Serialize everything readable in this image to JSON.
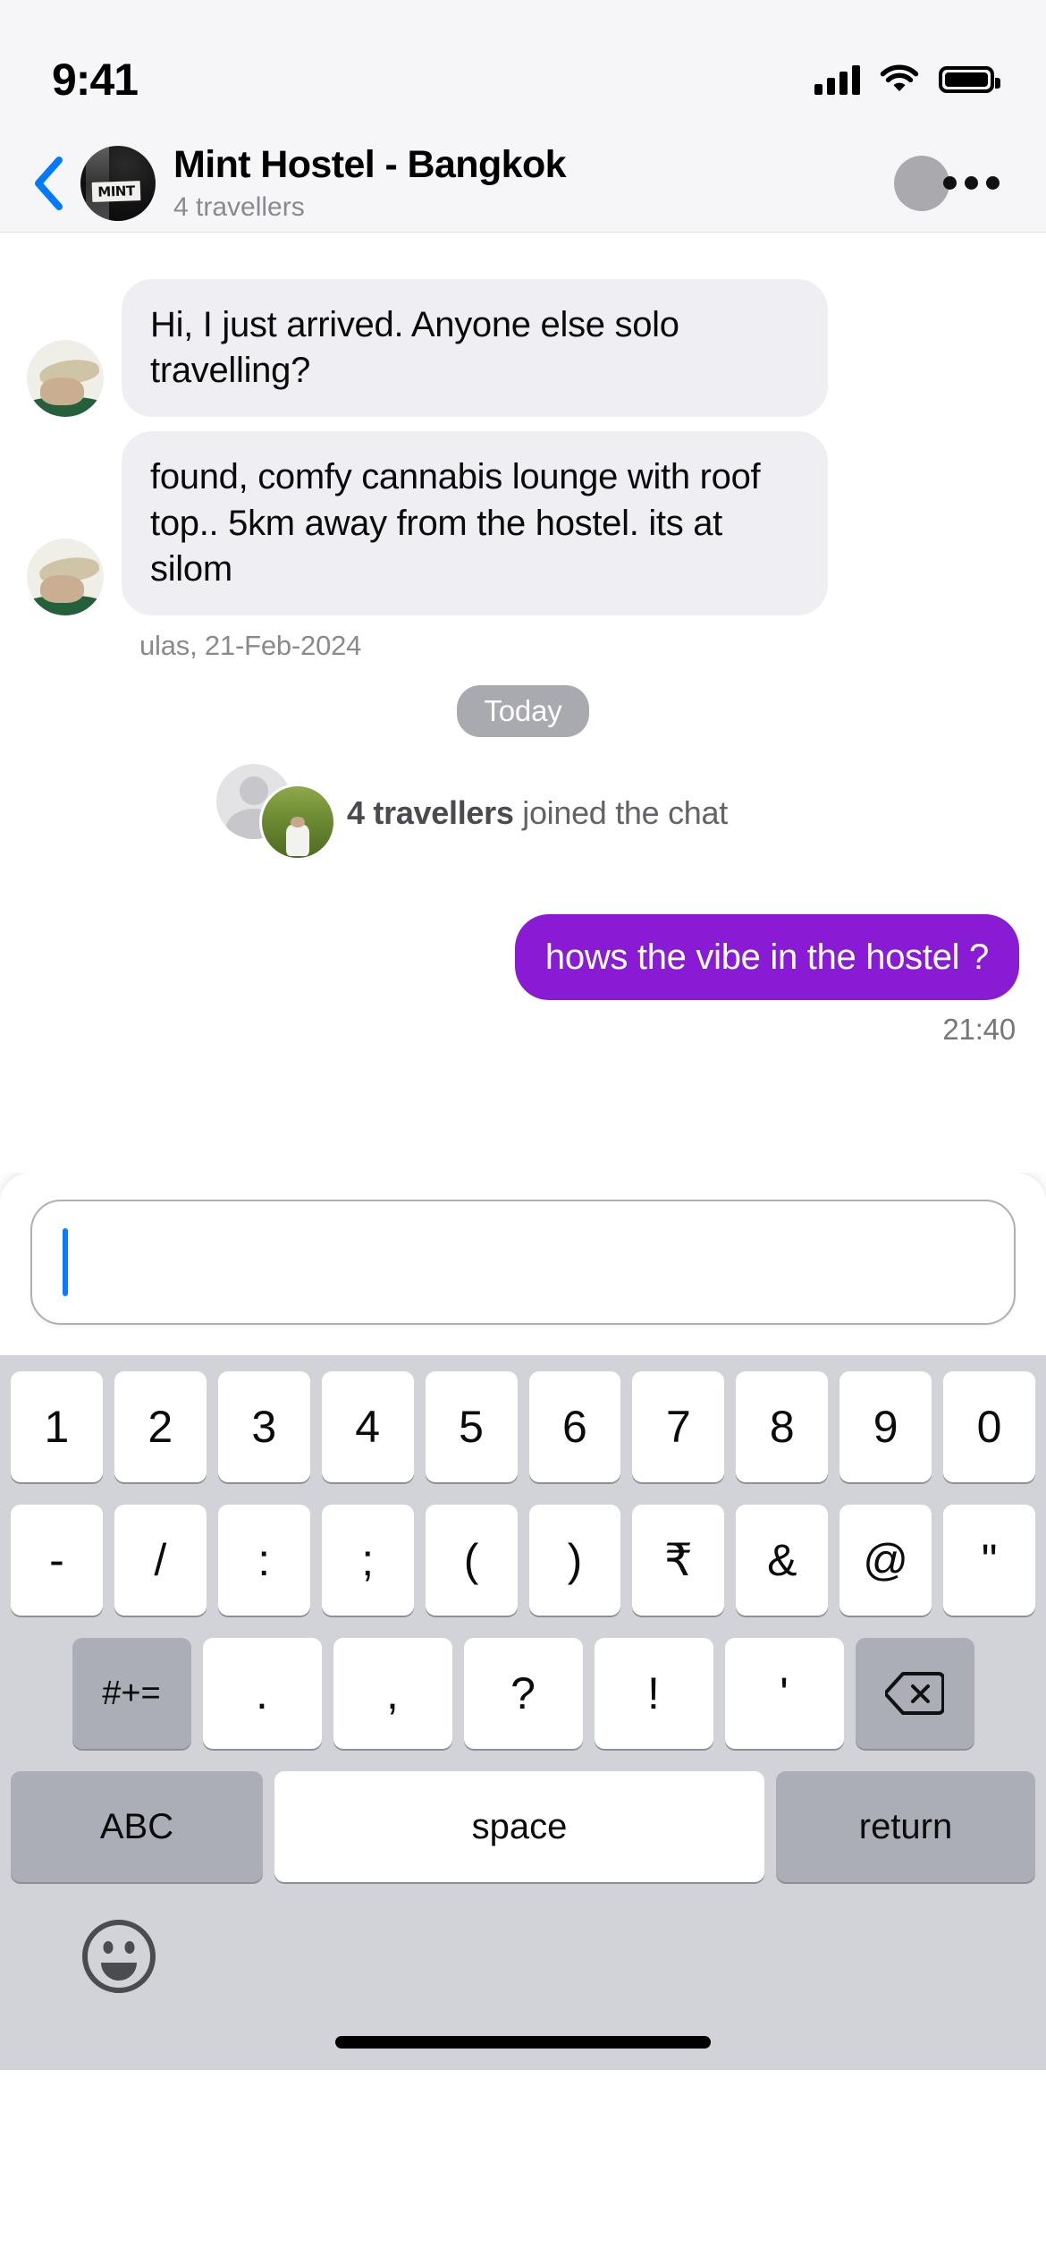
{
  "status_bar": {
    "time": "9:41",
    "signal_icon": "cellular-bars-icon",
    "wifi_icon": "wifi-icon",
    "battery_icon": "battery-full-icon"
  },
  "header": {
    "back_icon": "chevron-left-icon",
    "avatar_label": "MINT",
    "avatar_icon": "hostel-avatar",
    "title": "Mint Hostel - Bangkok",
    "subtitle": "4 travellers",
    "member_badge_icon": "member-avatar-icon",
    "more_icon": "more-options-icon",
    "back_color": "#007AFF"
  },
  "chat": {
    "messages": [
      {
        "id": "msg-1",
        "type": "incoming",
        "text": "Hi, I just arrived. Anyone else solo travelling?",
        "avatar_icon": "ulas-avatar"
      },
      {
        "id": "msg-2",
        "type": "incoming",
        "text": "found, comfy cannabis lounge with roof top.. 5km away from the hostel. its at silom",
        "avatar_icon": "ulas-avatar",
        "meta": "ulas, 21-Feb-2024"
      }
    ],
    "day_divider": "Today",
    "system_event": {
      "bold_text": "4 travellers",
      "rest_text": " joined the chat",
      "avatar_one_icon": "placeholder-avatar-icon",
      "avatar_two_icon": "traveller-avatar"
    },
    "outgoing": {
      "id": "msg-3",
      "text": "hows the vibe in the hostel ?",
      "time": "21:40",
      "bubble_color": "#8A1BD4"
    }
  },
  "composer": {
    "value": "",
    "placeholder": "",
    "caret_color": "#0A7CFF"
  },
  "keyboard": {
    "row1": [
      "1",
      "2",
      "3",
      "4",
      "5",
      "6",
      "7",
      "8",
      "9",
      "0"
    ],
    "row2": [
      "-",
      "/",
      ":",
      ";",
      "(",
      ")",
      "₹",
      "&",
      "@",
      "\""
    ],
    "row3_symbols_label": "#+=",
    "row3": [
      ".",
      ",",
      "?",
      "!",
      "'"
    ],
    "row3_backspace_icon": "backspace-icon",
    "row4": {
      "abc": "ABC",
      "space": "space",
      "return": "return"
    },
    "emoji_icon": "emoji-smiley-icon",
    "home_indicator_icon": "home-indicator"
  }
}
